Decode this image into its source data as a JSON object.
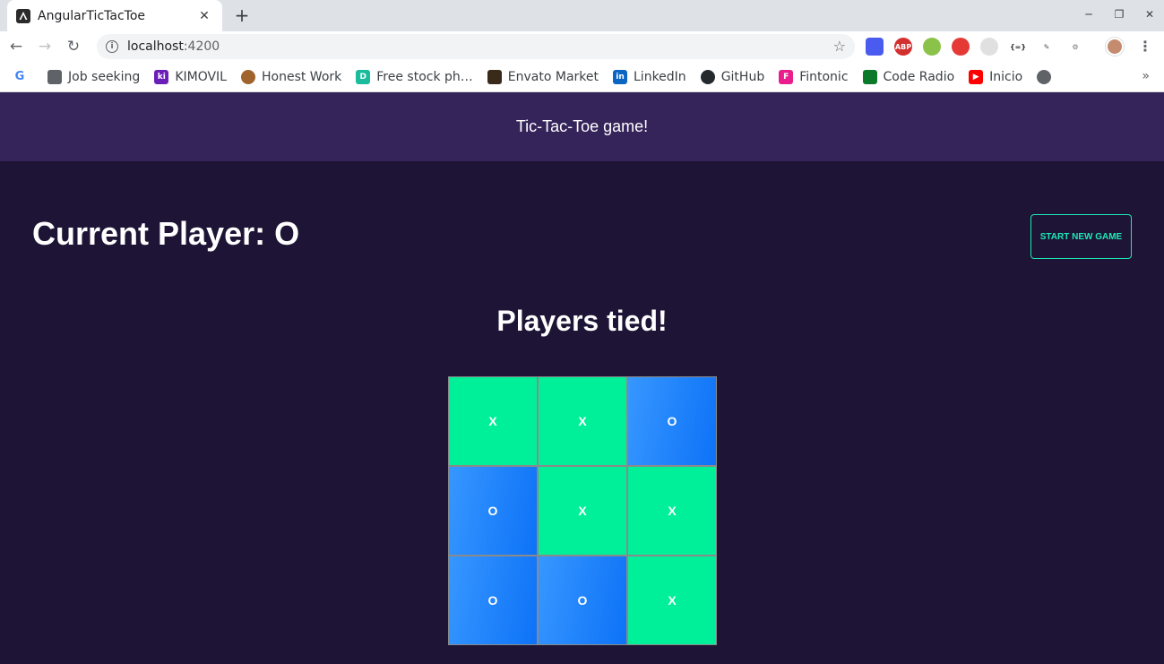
{
  "browser": {
    "tab_title": "AngularTicTacToe",
    "url_host": "localhost",
    "url_port": ":4200",
    "bookmarks": [
      {
        "label": "Job seeking",
        "icon": "folder-icon",
        "color": "#5f6368"
      },
      {
        "label": "KIMOVIL",
        "icon": "kimovil-icon",
        "color": "#6a1fb8"
      },
      {
        "label": "Honest Work",
        "icon": "honest-work-icon",
        "color": "#a0632c"
      },
      {
        "label": "Free stock ph…",
        "icon": "stock-photo-icon",
        "color": "#1abc9c"
      },
      {
        "label": "Envato Market",
        "icon": "envato-icon",
        "color": "#3a2a1a"
      },
      {
        "label": "LinkedIn",
        "icon": "linkedin-icon",
        "color": "#0a66c2"
      },
      {
        "label": "GitHub",
        "icon": "github-icon",
        "color": "#24292e"
      },
      {
        "label": "Fintonic",
        "icon": "fintonic-icon",
        "color": "#e91e8c"
      },
      {
        "label": "Code Radio",
        "icon": "code-radio-icon",
        "color": "#0a7a2a"
      },
      {
        "label": "Inicio",
        "icon": "youtube-icon",
        "color": "#ff0000"
      }
    ]
  },
  "app": {
    "title": "Tic-Tac-Toe game!",
    "current_player_label": "Current Player: O",
    "new_game_label": "START NEW GAME",
    "status": "Players tied!",
    "board": [
      "X",
      "X",
      "O",
      "O",
      "X",
      "X",
      "O",
      "O",
      "X"
    ],
    "colors": {
      "x_cell": "#00f09a",
      "o_cell": "#1a80fb",
      "header": "#35245a",
      "background": "#1e1435",
      "accent": "#1de9b6"
    }
  }
}
